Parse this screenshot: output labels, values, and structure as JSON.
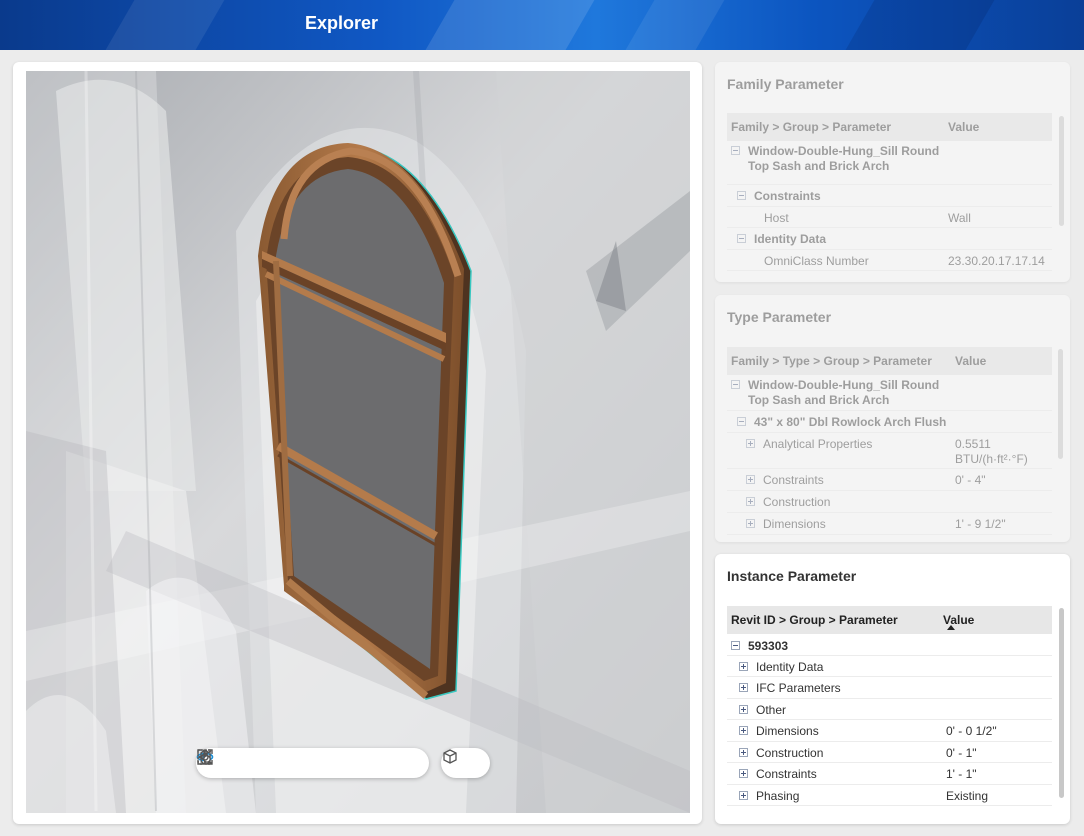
{
  "header": {
    "title": "Explorer"
  },
  "viewer": {
    "toolbar": {
      "tools": [
        {
          "name": "orbit-icon",
          "active": true
        },
        {
          "name": "first-person-icon",
          "active": false
        },
        {
          "name": "pan-icon",
          "active": false
        },
        {
          "name": "vertical-pan-icon",
          "active": false
        },
        {
          "name": "zoom-window-icon",
          "active": false
        },
        {
          "name": "fit-to-view-icon",
          "active": false
        }
      ],
      "view_tool": "view-cube-icon"
    }
  },
  "family_panel": {
    "title": "Family Parameter",
    "columns": [
      "Family > Group > Parameter",
      "Value"
    ],
    "rows": [
      {
        "label": "Window-Double-Hung_Sill Round Top Sash and Brick Arch",
        "value": ""
      },
      {
        "label": "Constraints",
        "value": ""
      },
      {
        "label": "Host",
        "value": "Wall"
      },
      {
        "label": "Identity Data",
        "value": ""
      },
      {
        "label": "OmniClass Number",
        "value": "23.30.20.17.17.14"
      }
    ]
  },
  "type_panel": {
    "title": "Type Parameter",
    "columns": [
      "Family > Type > Group > Parameter",
      "Value"
    ],
    "rows": [
      {
        "label": "Window-Double-Hung_Sill Round Top Sash and Brick Arch",
        "value": ""
      },
      {
        "label": "43\" x 80\" Dbl Rowlock Arch Flush",
        "value": ""
      },
      {
        "label": "Analytical Properties",
        "value": "0.5511 BTU/(h·ft²·°F)"
      },
      {
        "label": "Constraints",
        "value": "0' - 4\""
      },
      {
        "label": "Construction",
        "value": ""
      },
      {
        "label": "Dimensions",
        "value": "1' - 9 1/2\""
      }
    ]
  },
  "instance_panel": {
    "title": "Instance Parameter",
    "columns": [
      "Revit ID > Group > Parameter",
      "Value"
    ],
    "rows": [
      {
        "label": "593303",
        "value": ""
      },
      {
        "label": "Identity Data",
        "value": ""
      },
      {
        "label": "IFC Parameters",
        "value": ""
      },
      {
        "label": "Other",
        "value": ""
      },
      {
        "label": "Dimensions",
        "value": "0' - 0 1/2\""
      },
      {
        "label": "Construction",
        "value": "0' - 1\""
      },
      {
        "label": "Constraints",
        "value": "1' - 1\""
      },
      {
        "label": "Phasing",
        "value": "Existing"
      }
    ]
  }
}
